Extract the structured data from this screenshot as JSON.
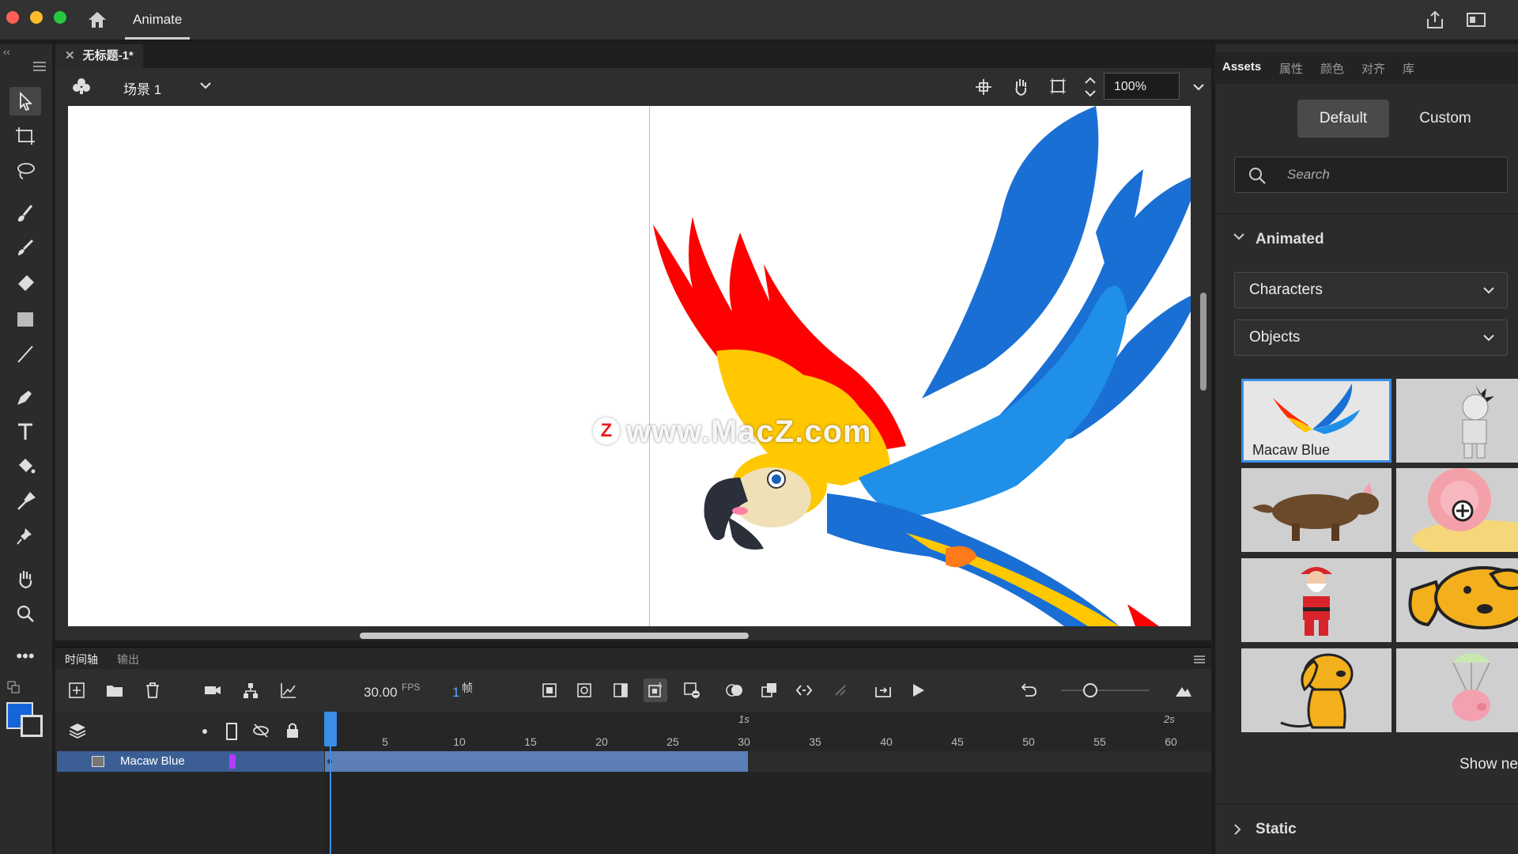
{
  "app": {
    "name": "Animate",
    "document_tab": "无标题-1*",
    "scene": "场景 1",
    "zoom": "100%"
  },
  "stage": {
    "watermark": "www.MacZ.com",
    "watermark_badge": "Z"
  },
  "timeline": {
    "tabs": [
      "时间轴",
      "输出"
    ],
    "fps_value": "30.00",
    "fps_unit": "FPS",
    "current_frame": "1",
    "frame_unit": "帧",
    "second_markers": [
      "1s",
      "2s"
    ],
    "frame_numbers": [
      "5",
      "10",
      "15",
      "20",
      "25",
      "30",
      "35",
      "40",
      "45",
      "50",
      "55",
      "60"
    ],
    "layers": [
      {
        "name": "Macaw Blue",
        "span_frames": 30
      }
    ]
  },
  "assets_panel": {
    "tabs": [
      "Assets",
      "属性",
      "颜色",
      "对齐",
      "库"
    ],
    "active_tab": "Assets",
    "segments": [
      "Default",
      "Custom"
    ],
    "active_segment": "Default",
    "search_placeholder": "Search",
    "section_animated": "Animated",
    "dropdowns": [
      "Characters",
      "Objects"
    ],
    "thumbnails": [
      {
        "label": "Macaw Blue",
        "icon": "macaw-thumb",
        "selected": true
      },
      {
        "label": "",
        "icon": "mummy-thumb"
      },
      {
        "label": "",
        "icon": "wolf-thumb"
      },
      {
        "label": "",
        "icon": "snail-thumb"
      },
      {
        "label": "",
        "icon": "santa-thumb"
      },
      {
        "label": "",
        "icon": "dog-thumb"
      },
      {
        "label": "",
        "icon": "dog-sitting-thumb"
      },
      {
        "label": "",
        "icon": "pig-parachute-thumb"
      }
    ],
    "show_new": "Show ne",
    "section_static": "Static"
  },
  "colors": {
    "accent": "#3a8ee6",
    "fill_swatch": "#1565d8",
    "layer_span": "#5b7fb6",
    "playhead": "#3a8ee6"
  }
}
